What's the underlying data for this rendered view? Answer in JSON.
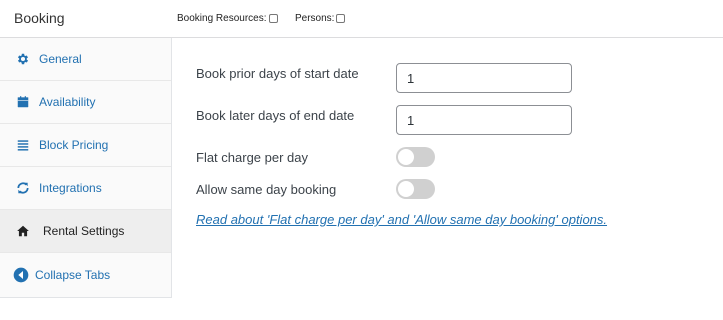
{
  "header": {
    "title": "Booking",
    "options": [
      {
        "label": "Booking Resources:",
        "checked": false
      },
      {
        "label": "Persons:",
        "checked": false
      }
    ]
  },
  "sidebar": {
    "items": [
      {
        "label": "General",
        "icon": "gear-icon",
        "active": false
      },
      {
        "label": "Availability",
        "icon": "calendar-icon",
        "active": false
      },
      {
        "label": "Block Pricing",
        "icon": "list-icon",
        "active": false
      },
      {
        "label": "Integrations",
        "icon": "sync-icon",
        "active": false
      },
      {
        "label": "Rental Settings",
        "icon": "home-icon",
        "active": true
      },
      {
        "label": "Collapse Tabs",
        "icon": "collapse-arrow-icon",
        "active": false
      }
    ]
  },
  "rental": {
    "prior_days": {
      "label": "Book prior days of start date",
      "value": "1"
    },
    "later_days": {
      "label": "Book later days of end date",
      "value": "1"
    },
    "flat_charge": {
      "label": "Flat charge per day",
      "enabled": false
    },
    "same_day": {
      "label": "Allow same day booking",
      "enabled": false
    },
    "help_link": "Read about 'Flat charge per day' and 'Allow same day booking' options."
  },
  "colors": {
    "accent": "#2271b1",
    "toggle_off": "#d0d0d0",
    "active_tab_bg": "#eeeeee"
  }
}
